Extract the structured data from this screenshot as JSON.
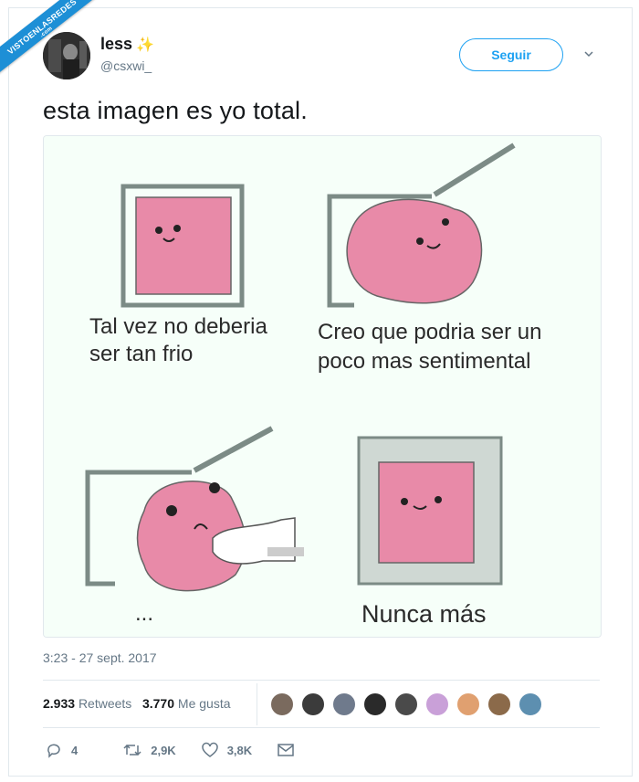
{
  "watermark": {
    "text": "VISTOENLASREDES",
    "sub": ".com"
  },
  "author": {
    "name": "less",
    "handle": "@csxwi_",
    "sparkle": "✨"
  },
  "follow_label": "Seguir",
  "tweet_text": "esta imagen es yo total.",
  "comic": {
    "panel1": [
      "Tal vez no deberia",
      "ser tan frio"
    ],
    "panel2": [
      "Creo que podria ser un",
      "poco mas sentimental"
    ],
    "panel3": "...",
    "panel4": "Nunca más"
  },
  "timestamp": "3:23 - 27 sept. 2017",
  "stats": {
    "retweets_count": "2.933",
    "retweets_label": "Retweets",
    "likes_count": "3.770",
    "likes_label": "Me gusta"
  },
  "likers": [
    "#7a6a5e",
    "#3b3b3b",
    "#6f7a8c",
    "#2a2a2a",
    "#4a4a4a",
    "#c9a0d8",
    "#e0a070",
    "#8b6a4a",
    "#5d8fb0"
  ],
  "actions": {
    "replies": "4",
    "retweets": "2,9K",
    "likes": "3,8K"
  },
  "colors": {
    "accent": "#1da1f2",
    "muted": "#657786",
    "pink": "#e88aa8"
  }
}
